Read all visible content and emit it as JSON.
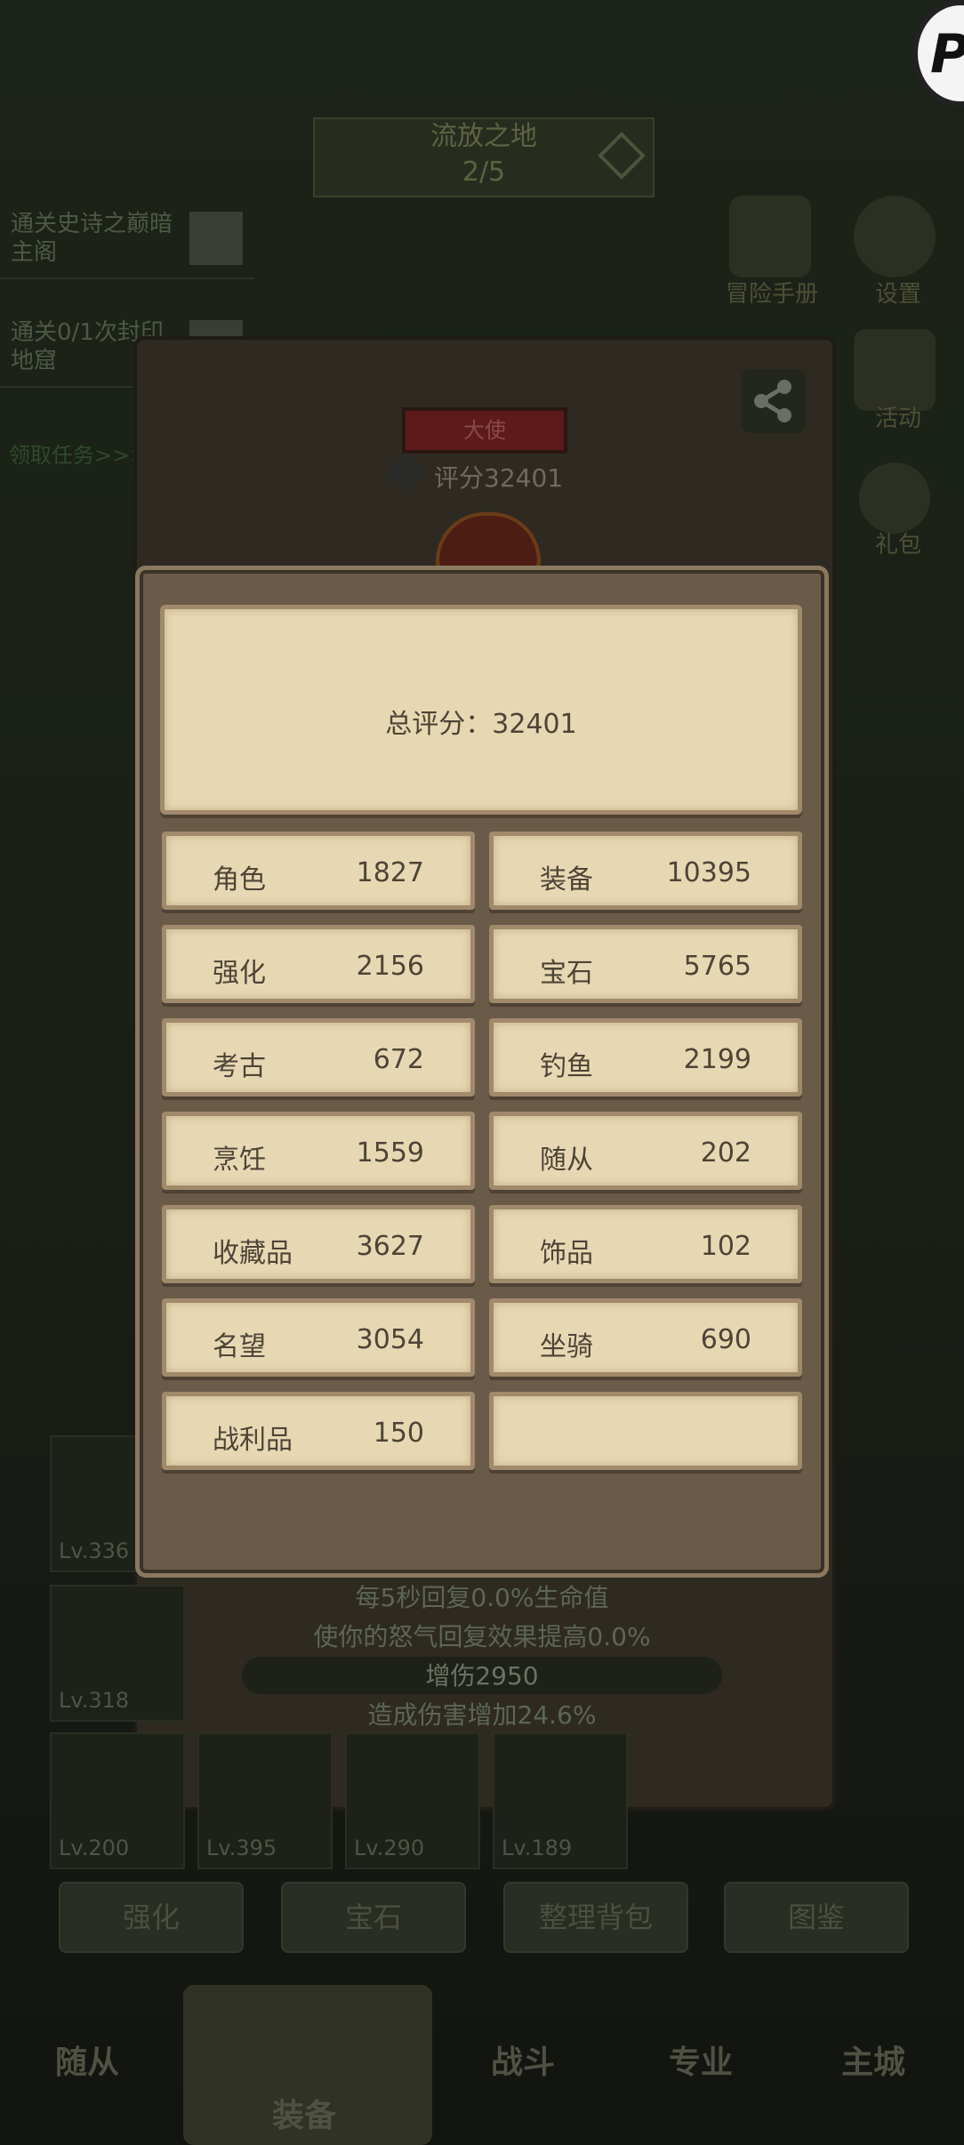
{
  "background": {
    "level_name": "流放之地",
    "level_progress": "2/5",
    "quests": [
      "通关史诗之巅暗主阁",
      "通关0/1次封印地窟"
    ],
    "quest_link": "领取任务>>>",
    "side_icons": [
      "冒险手册",
      "设置",
      "活动",
      "礼包"
    ],
    "rank_badge": "大使",
    "rating": "评分32401",
    "stat_lines": [
      "每5秒回复0.0%生命值",
      "使你的怒气回复效果提高0.0%",
      "增伤2950",
      "造成伤害增加24.6%"
    ],
    "slot_levels": [
      "Lv.336",
      "Lv.318",
      "Lv.200",
      "Lv.395",
      "Lv.290",
      "Lv.189"
    ],
    "buttons": [
      "强化",
      "宝石",
      "整理背包",
      "图鉴"
    ],
    "tabs": [
      "随从",
      "装备",
      "战斗",
      "专业",
      "主城"
    ]
  },
  "modal": {
    "total_label": "总评分：32401",
    "cells": [
      {
        "label": "角色",
        "value": "1827"
      },
      {
        "label": "装备",
        "value": "10395"
      },
      {
        "label": "强化",
        "value": "2156"
      },
      {
        "label": "宝石",
        "value": "5765"
      },
      {
        "label": "考古",
        "value": "672"
      },
      {
        "label": "钓鱼",
        "value": "2199"
      },
      {
        "label": "烹饪",
        "value": "1559"
      },
      {
        "label": "随从",
        "value": "202"
      },
      {
        "label": "收藏品",
        "value": "3627"
      },
      {
        "label": "饰品",
        "value": "102"
      },
      {
        "label": "名望",
        "value": "3054"
      },
      {
        "label": "坐骑",
        "value": "690"
      },
      {
        "label": "战利品",
        "value": "150"
      },
      {
        "label": "",
        "value": ""
      }
    ]
  }
}
